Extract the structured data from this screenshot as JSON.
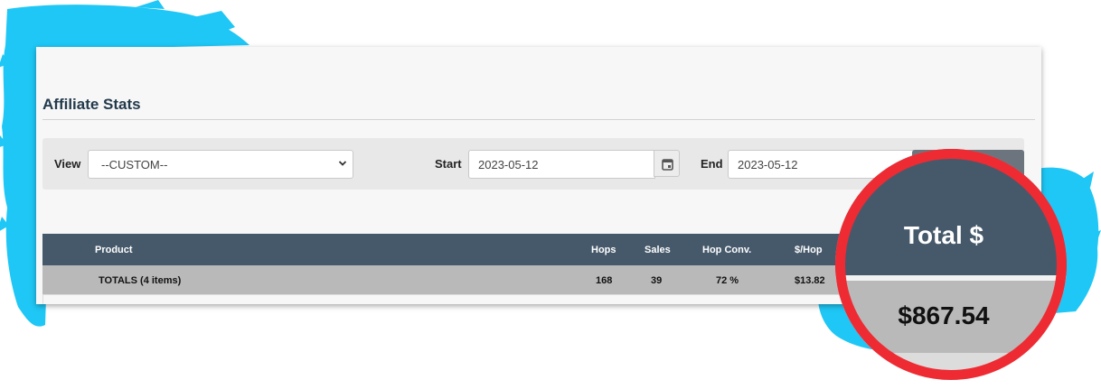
{
  "page": {
    "title": "Affiliate Stats"
  },
  "filters": {
    "view_label": "View",
    "view_value": "--CUSTOM--",
    "start_label": "Start",
    "start_value": "2023-05-12",
    "end_label": "End",
    "end_value": "2023-05-12"
  },
  "table": {
    "columns": [
      "Product",
      "Hops",
      "Sales",
      "Hop Conv.",
      "$/Hop"
    ],
    "totals_row": {
      "label": "TOTALS (4 items)",
      "hops": "168",
      "sales": "39",
      "hop_conv": "72 %",
      "per_hop": "$13.82"
    }
  },
  "callout": {
    "label": "Total $",
    "value": "$867.54"
  },
  "colors": {
    "header": "#46596b",
    "totals_row": "#b9b9b9",
    "highlight_ring": "#ee2b33",
    "brush_splash": "#1ec7f5"
  },
  "icons": [
    "chevron-down-icon",
    "calendar-icon"
  ]
}
